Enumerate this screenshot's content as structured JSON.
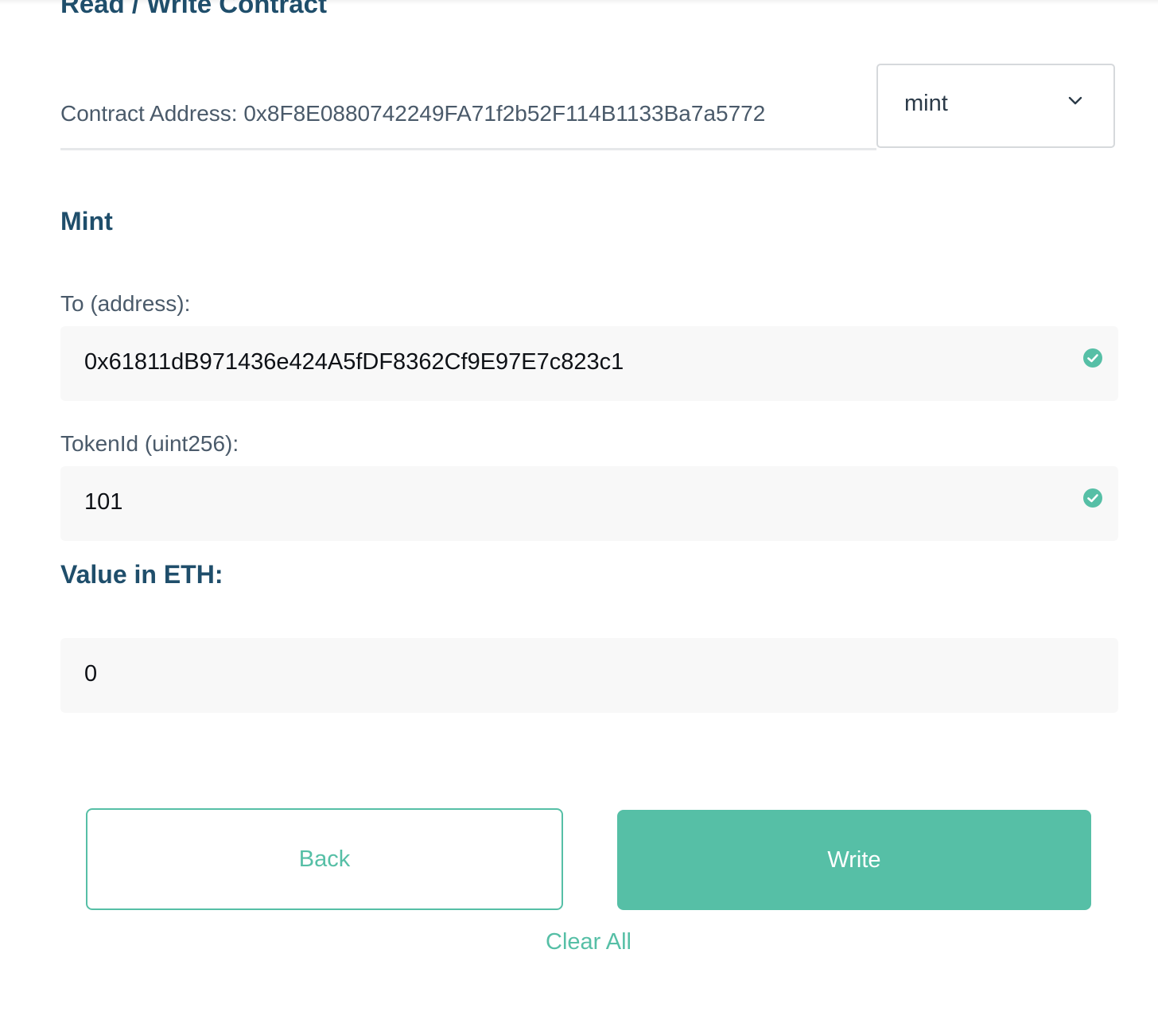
{
  "header": {
    "title": "Read / Write Contract"
  },
  "contract": {
    "address_text": "Contract Address: 0x8F8E0880742249FA71f2b52F114B1133Ba7a5772"
  },
  "method_select": {
    "selected": "mint",
    "icon": "chevron-down-icon"
  },
  "section": {
    "title": "Mint"
  },
  "fields": [
    {
      "label": "To (address):",
      "value": "0x61811dB971436e424A5fDF8362Cf9E97E7c823c1",
      "valid": true
    },
    {
      "label": "TokenId (uint256):",
      "value": "101",
      "valid": true
    }
  ],
  "value_eth": {
    "label": "Value in ETH:",
    "value": "0"
  },
  "actions": {
    "back_label": "Back",
    "write_label": "Write",
    "clear_label": "Clear All"
  },
  "colors": {
    "accent": "#56bfa6",
    "heading": "#1f4e6b",
    "text_muted": "#4a5a6a",
    "input_bg": "#f8f8f8"
  }
}
